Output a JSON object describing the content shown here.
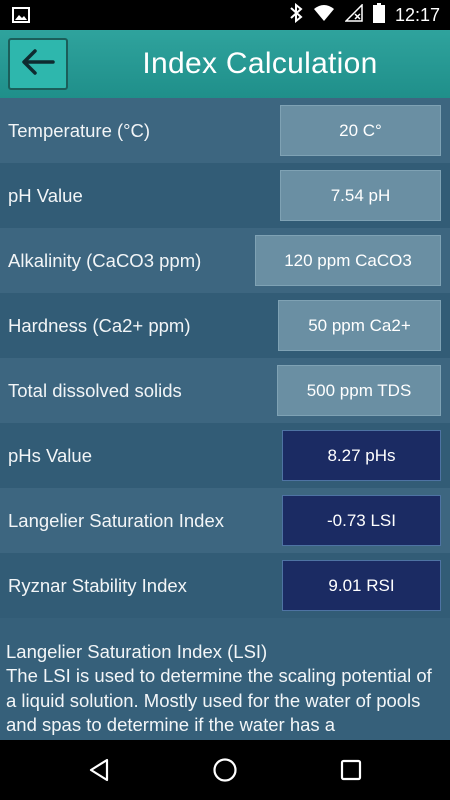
{
  "status_bar": {
    "time": "12:17",
    "icons": [
      "image-icon",
      "bluetooth-icon",
      "wifi-icon",
      "cellular-off-icon",
      "battery-icon"
    ]
  },
  "app_bar": {
    "title": "Index Calculation",
    "back_icon": "arrow-left-icon"
  },
  "rows": [
    {
      "label": "Temperature (°C)",
      "value": "20 C°",
      "kind": "input"
    },
    {
      "label": "pH Value",
      "value": "7.54 pH",
      "kind": "input"
    },
    {
      "label": "Alkalinity (CaCO3 ppm)",
      "value": "120 ppm CaCO3",
      "kind": "input"
    },
    {
      "label": "Hardness (Ca2+ ppm)",
      "value": "50 ppm Ca2+",
      "kind": "input"
    },
    {
      "label": "Total dissolved solids",
      "value": "500 ppm TDS",
      "kind": "input"
    },
    {
      "label": "pHs Value",
      "value": "8.27 pHs",
      "kind": "result"
    },
    {
      "label": "Langelier Saturation Index",
      "value": "-0.73 LSI",
      "kind": "result"
    },
    {
      "label": "Ryznar Stability Index",
      "value": "9.01 RSI",
      "kind": "result"
    }
  ],
  "info": {
    "title": "Langelier Saturation Index (LSI)",
    "body": "The LSI is used to determine the scaling potential of a liquid solution. Mostly used for the water of pools and spas to determine if the water has a"
  },
  "nav_bar": {
    "icons": [
      "back-triangle-icon",
      "home-circle-icon",
      "recents-square-icon"
    ]
  },
  "colors": {
    "app_bar": "#2fa39d",
    "back_button": "#2eb7ad",
    "content_bg": "#36607a",
    "input_field": "#6a8fa3",
    "result_field": "#1b2b63"
  }
}
